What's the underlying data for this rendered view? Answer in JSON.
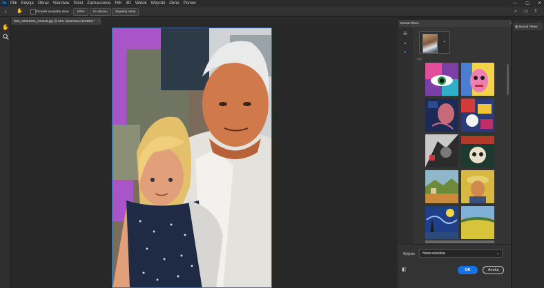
{
  "app": {
    "logo": "Ps"
  },
  "menu": [
    "Plik",
    "Edycja",
    "Obraz",
    "Warstwa",
    "Tekst",
    "Zaznaczenie",
    "Filtr",
    "3D",
    "Widok",
    "Wtyczki",
    "Okno",
    "Pomoc"
  ],
  "window_controls": {
    "minimize": "—",
    "maximize": "▢",
    "close": "✕"
  },
  "options_bar": {
    "back_icon": "back-arrow-icon",
    "hand_icon": "hand-tool-icon",
    "scroll_all_label": "Przewiń wszystkie okna",
    "zoom_100_label": "100%",
    "fit_screen_label": "Do ekranu",
    "fill_screen_label": "Wypełnij ekran",
    "search_icon": "search-icon",
    "workspace_icon": "workspace-icon",
    "share_icon": "share-icon"
  },
  "tools": [
    {
      "name": "hand-tool-icon",
      "glyph": "✋"
    },
    {
      "name": "zoom-tool-icon",
      "glyph": "🔍"
    }
  ],
  "document_tab": {
    "title": "IMG_20201224_214249.jpg @ 25% (Warstwa 0,RGB/8) *",
    "close": "×"
  },
  "neural_filters": {
    "panel_title": "Neural Filters",
    "close": "×",
    "preview_chevron": "⌄",
    "section_label": "Styl",
    "output_label": "Wyjście",
    "output_value": "Nowa warstwa",
    "ok_label": "OK",
    "cancel_label": "Anuluj",
    "styles": [
      "pop-art-eye",
      "pop-art-portrait",
      "blue-sketch",
      "abstract-collage",
      "dark-illustration",
      "tattoo-skull",
      "landscape-painting",
      "van-gogh-self-portrait",
      "starry-night",
      "wheat-field"
    ]
  },
  "right_dock": {
    "button_label": "Neural Filters"
  },
  "colors": {
    "accent": "#1473e6",
    "panel": "#343434",
    "background": "#252525"
  }
}
